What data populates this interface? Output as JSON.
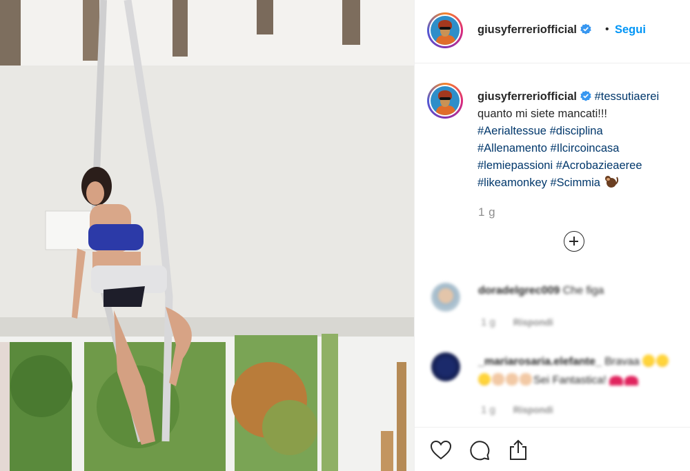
{
  "post": {
    "username": "giusyferreriofficial",
    "verified": true,
    "separator": "•",
    "follow_label": "Segui"
  },
  "caption": {
    "username": "giusyferreriofficial",
    "hashtag_first": "#tessutiaerei",
    "line_text": "quanto mi siete mancati!!!",
    "hashtags_lines": [
      [
        "#Aerialtessue",
        "#disciplina"
      ],
      [
        "#Allenamento",
        "#Ilcircoincasa"
      ],
      [
        "#lemiepassioni",
        "#Acrobazieaeree"
      ],
      [
        "#likeamonkey",
        "#Scimmia"
      ]
    ],
    "emoji": "monkey-emoji",
    "time": "1 g"
  },
  "load_more_icon": "plus-circle-icon",
  "comments": [
    {
      "username": "doradelgrec009",
      "text": "Che figa",
      "time": "1 g",
      "reply": "Rispondi"
    },
    {
      "username": "_mariarosaria.elefante_",
      "text_start": "Bravaa",
      "text_end": "Sei Fantastica!",
      "time": "1 g",
      "reply": "Rispondi"
    }
  ],
  "actions": [
    "heart-icon",
    "comment-icon",
    "share-icon"
  ],
  "colors": {
    "link": "#0095f6",
    "hashtag": "#00376b",
    "muted": "#8e8e8e",
    "text": "#262626"
  }
}
